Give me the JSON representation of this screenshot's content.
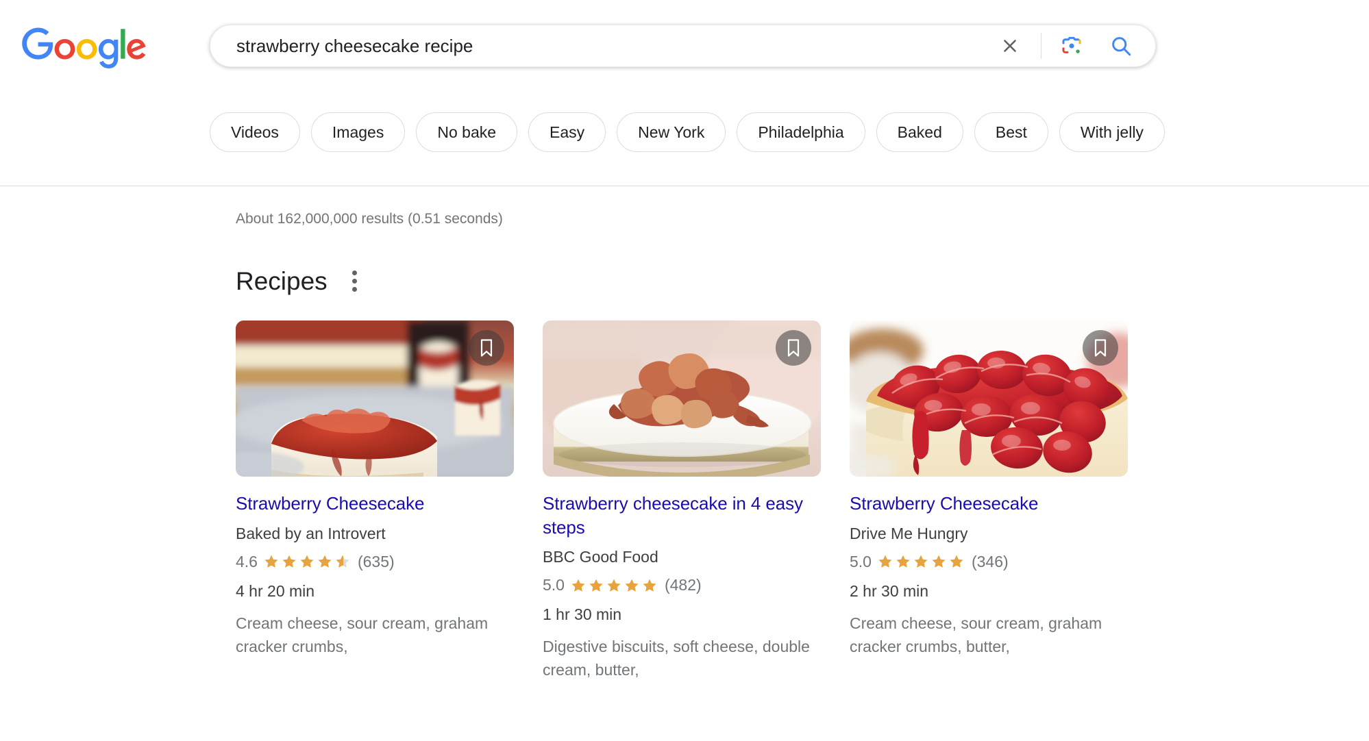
{
  "brand": {
    "logo_name": "Google",
    "colors": {
      "blue": "#4285F4",
      "red": "#EA4335",
      "yellow": "#FBBC05",
      "green": "#34A853",
      "link": "#1a0dab",
      "star": "#e7a33e",
      "star_empty": "#dadce0"
    }
  },
  "search": {
    "query": "strawberry cheesecake recipe",
    "placeholder": "Search",
    "clear_icon": "close-icon",
    "lens_icon": "google-lens-camera-icon",
    "search_icon": "magnifier-icon"
  },
  "chips": [
    {
      "label": "Videos"
    },
    {
      "label": "Images"
    },
    {
      "label": "No bake"
    },
    {
      "label": "Easy"
    },
    {
      "label": "New York"
    },
    {
      "label": "Philadelphia"
    },
    {
      "label": "Baked"
    },
    {
      "label": "Best"
    },
    {
      "label": "With jelly"
    }
  ],
  "results": {
    "stats": "About 162,000,000 results (0.51 seconds)",
    "section_title": "Recipes",
    "overflow_icon": "three-dots-vertical-icon",
    "bookmark_icon": "bookmark-icon"
  },
  "recipes": [
    {
      "title": "Strawberry Cheesecake",
      "source": "Baked by an Introvert",
      "rating": "4.6",
      "rating_value": 4.6,
      "reviews": "(635)",
      "time": "4 hr 20 min",
      "ingredients": "Cream cheese, sour cream, graham cracker crumbs,",
      "image_alt": "slice-of-strawberry-cheesecake-on-plate"
    },
    {
      "title": "Strawberry cheesecake in 4 easy steps",
      "source": "BBC Good Food",
      "rating": "5.0",
      "rating_value": 5.0,
      "reviews": "(482)",
      "time": "1 hr 30 min",
      "ingredients": "Digestive biscuits, soft cheese, double cream, butter,",
      "image_alt": "whole-no-bake-cheesecake-with-strawberries"
    },
    {
      "title": "Strawberry Cheesecake",
      "source": "Drive Me Hungry",
      "rating": "5.0",
      "rating_value": 5.0,
      "reviews": "(346)",
      "time": "2 hr 30 min",
      "ingredients": "Cream cheese, sour cream, graham cracker crumbs, butter,",
      "image_alt": "cheesecake-topped-with-glossy-strawberries"
    }
  ]
}
